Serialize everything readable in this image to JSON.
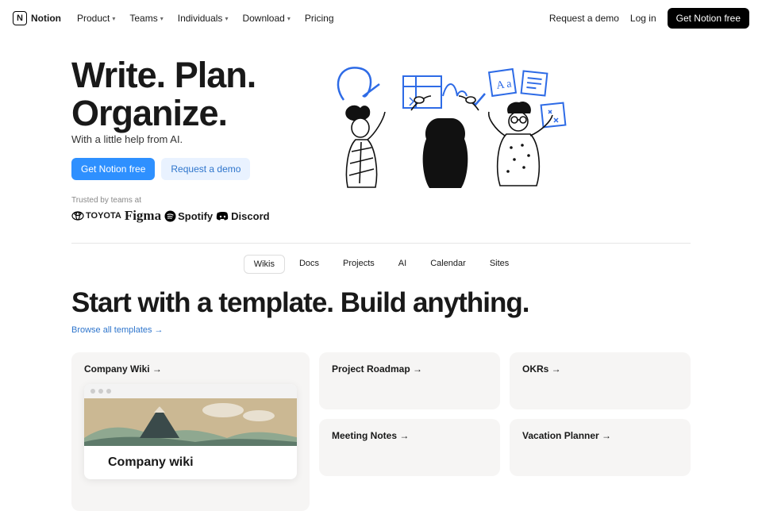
{
  "nav": {
    "brand": "Notion",
    "items": [
      {
        "label": "Product",
        "dropdown": true
      },
      {
        "label": "Teams",
        "dropdown": true
      },
      {
        "label": "Individuals",
        "dropdown": true
      },
      {
        "label": "Download",
        "dropdown": true
      },
      {
        "label": "Pricing",
        "dropdown": false
      }
    ],
    "right": {
      "demo": "Request a demo",
      "login": "Log in",
      "cta": "Get Notion free"
    }
  },
  "hero": {
    "headline_1": "Write. Plan.",
    "headline_2": "Organize.",
    "sub": "With a little help from AI.",
    "cta_primary": "Get Notion free",
    "cta_secondary": "Request a demo",
    "trusted_label": "Trusted by teams at",
    "brands": [
      "TOYOTA",
      "Figma",
      "Spotify",
      "Discord"
    ]
  },
  "tabs": [
    "Wikis",
    "Docs",
    "Projects",
    "AI",
    "Calendar",
    "Sites"
  ],
  "tabs_active": "Wikis",
  "templates_section": {
    "headline": "Start with a template. Build anything.",
    "browse_link": "Browse all templates →",
    "cards": {
      "big": {
        "title": "Company Wiki →",
        "preview_title": "Company wiki"
      },
      "small": [
        "Project Roadmap →",
        "OKRs →",
        "Meeting Notes →",
        "Vacation Planner →"
      ]
    }
  }
}
